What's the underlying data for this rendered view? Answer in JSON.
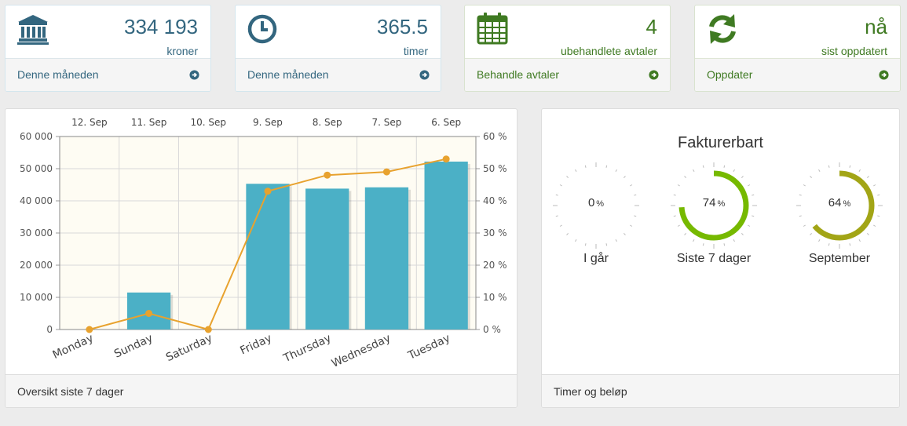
{
  "stats": [
    {
      "value": "334 193",
      "sub": "kroner",
      "footer": "Denne måneden",
      "icon": "bank-icon",
      "color": "#33667f"
    },
    {
      "value": "365.5",
      "sub": "timer",
      "footer": "Denne måneden",
      "icon": "clock-icon",
      "color": "#33667f"
    },
    {
      "value": "4",
      "sub": "ubehandlete avtaler",
      "footer": "Behandle avtaler",
      "icon": "calendar-icon",
      "color": "#3f7a22"
    },
    {
      "value": "nå",
      "sub": "sist oppdatert",
      "footer": "Oppdater",
      "icon": "refresh-icon",
      "color": "#3f7a22"
    }
  ],
  "chart_panel": {
    "footer": "Oversikt siste 7 dager"
  },
  "chart_data": {
    "type": "bar",
    "categories": [
      "Monday",
      "Sunday",
      "Saturday",
      "Friday",
      "Thursday",
      "Wednesday",
      "Tuesday"
    ],
    "top_categories": [
      "12. Sep",
      "11. Sep",
      "10. Sep",
      "9. Sep",
      "8. Sep",
      "7. Sep",
      "6. Sep"
    ],
    "series": [
      {
        "type": "bar",
        "axis": "left",
        "color": "#4bb0c6",
        "values": [
          0,
          11500,
          0,
          45300,
          43800,
          44200,
          52200
        ]
      },
      {
        "type": "line",
        "axis": "right",
        "color": "#e8a22e",
        "values": [
          0,
          5,
          0,
          43,
          48,
          49,
          53
        ]
      }
    ],
    "left_axis": {
      "min": 0,
      "max": 60000,
      "ticks": [
        "0",
        "10 000",
        "20 000",
        "30 000",
        "40 000",
        "50 000",
        "60 000"
      ]
    },
    "right_axis": {
      "min": 0,
      "max": 60,
      "ticks": [
        "0 %",
        "10 %",
        "20 %",
        "30 %",
        "40 %",
        "50 %",
        "60 %"
      ]
    },
    "grid": true
  },
  "gauge_panel": {
    "title": "Fakturerbart",
    "footer": "Timer og beløp",
    "gauges": [
      {
        "value": 0,
        "unit": "%",
        "label": "I går",
        "color": "#8fb814"
      },
      {
        "value": 74,
        "unit": "%",
        "label": "Siste 7 dager",
        "color": "#76b900"
      },
      {
        "value": 64,
        "unit": "%",
        "label": "September",
        "color": "#a2a516"
      }
    ]
  }
}
